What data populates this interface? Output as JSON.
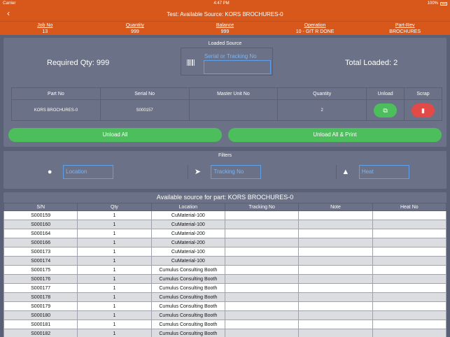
{
  "status": {
    "carrier": "Carrier",
    "time": "4:47 PM",
    "battery": "100%"
  },
  "nav": {
    "title": "Test: Available Source: KORS BROCHURES-0"
  },
  "info": [
    {
      "label": "Job No",
      "value": "13"
    },
    {
      "label": "Quantity",
      "value": "999"
    },
    {
      "label": "Balance",
      "value": "999"
    },
    {
      "label": "Operation",
      "value": "10 - GIT R DONE"
    },
    {
      "label": "Part-Rev",
      "value": "BROCHURES"
    }
  ],
  "loaded": {
    "title": "Loaded Source",
    "required_qty": "Required Qty: 999",
    "total_loaded": "Total Loaded: 2",
    "serial_label": "Serial or Tracking No",
    "columns": [
      "Part No",
      "Serial No",
      "Master Unit No",
      "Quantity",
      "Unload",
      "Scrap"
    ],
    "row": {
      "part_no": "KORS BROCHURES-0",
      "serial_no": "S000157",
      "master_unit_no": "",
      "quantity": "2"
    },
    "unload_all": "Unload All",
    "unload_all_print": "Unload All & Print"
  },
  "filters": {
    "title": "Filters",
    "location": "Location",
    "tracking": "Tracking No",
    "heat": "Heat"
  },
  "source": {
    "title": "Available source for part: KORS BROCHURES-0",
    "columns": [
      "S/N",
      "Qty",
      "Location",
      "Tracking No",
      "Note",
      "Heat No"
    ],
    "rows": [
      [
        "S000159",
        "1",
        "CuMaterial-100",
        "",
        "",
        ""
      ],
      [
        "S000160",
        "1",
        "CuMaterial-100",
        "",
        "",
        ""
      ],
      [
        "S000164",
        "1",
        "CuMaterial-200",
        "",
        "",
        ""
      ],
      [
        "S000166",
        "1",
        "CuMaterial-200",
        "",
        "",
        ""
      ],
      [
        "S000173",
        "1",
        "CuMaterial-100",
        "",
        "",
        ""
      ],
      [
        "S000174",
        "1",
        "CuMaterial-100",
        "",
        "",
        ""
      ],
      [
        "S000175",
        "1",
        "Cumulus Consulting Booth",
        "",
        "",
        ""
      ],
      [
        "S000176",
        "1",
        "Cumulus Consulting Booth",
        "",
        "",
        ""
      ],
      [
        "S000177",
        "1",
        "Cumulus Consulting Booth",
        "",
        "",
        ""
      ],
      [
        "S000178",
        "1",
        "Cumulus Consulting Booth",
        "",
        "",
        ""
      ],
      [
        "S000179",
        "1",
        "Cumulus Consulting Booth",
        "",
        "",
        ""
      ],
      [
        "S000180",
        "1",
        "Cumulus Consulting Booth",
        "",
        "",
        ""
      ],
      [
        "S000181",
        "1",
        "Cumulus Consulting Booth",
        "",
        "",
        ""
      ],
      [
        "S000182",
        "1",
        "Cumulus Consulting Booth",
        "",
        "",
        ""
      ]
    ]
  }
}
